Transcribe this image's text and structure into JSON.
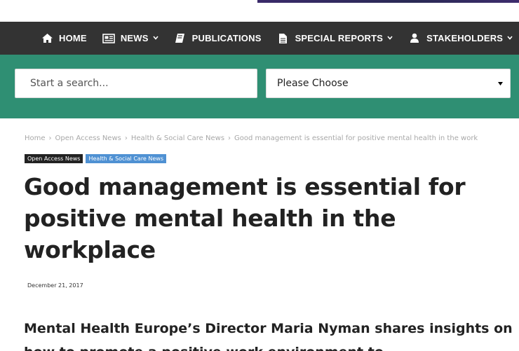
{
  "nav": {
    "items": [
      {
        "label": "HOME",
        "icon": "home-icon"
      },
      {
        "label": "NEWS",
        "icon": "newspaper-icon",
        "dropdown": true
      },
      {
        "label": "PUBLICATIONS",
        "icon": "book-icon"
      },
      {
        "label": "SPECIAL REPORTS",
        "icon": "document-icon",
        "dropdown": true
      },
      {
        "label": "STAKEHOLDERS",
        "icon": "user-icon",
        "dropdown": true
      }
    ]
  },
  "search": {
    "placeholder": "Start a search...",
    "select_value": "Please Choose"
  },
  "breadcrumb": [
    "Home",
    "Open Access News",
    "Health & Social Care News",
    "Good management is essential for positive mental health in the work"
  ],
  "tags": [
    "Open Access News",
    "Health & Social Care News"
  ],
  "article": {
    "title": "Good management is essential for positive mental health in the workplace",
    "date": "December 21, 2017",
    "lead": "Mental Health Europe’s Director Maria Nyman shares insights on how to promote a positive work environment to"
  },
  "colors": {
    "nav_bg": "#333333",
    "search_bg": "#2f8f73",
    "tag_dark": "#222222",
    "tag_blue": "#4f91d3"
  }
}
